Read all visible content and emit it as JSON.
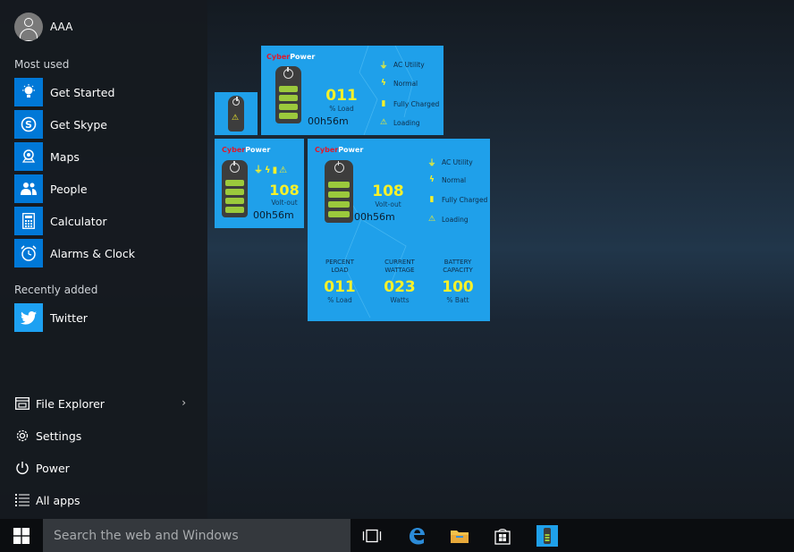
{
  "user": {
    "name": "AAA"
  },
  "sections": {
    "most_used": "Most used",
    "recently_added": "Recently added"
  },
  "apps": [
    {
      "label": "Get Started",
      "icon": "lightbulb-icon"
    },
    {
      "label": "Get Skype",
      "icon": "skype-icon"
    },
    {
      "label": "Maps",
      "icon": "maps-icon"
    },
    {
      "label": "People",
      "icon": "people-icon"
    },
    {
      "label": "Calculator",
      "icon": "calculator-icon"
    },
    {
      "label": "Alarms & Clock",
      "icon": "alarm-clock-icon"
    }
  ],
  "recent": [
    {
      "label": "Twitter",
      "icon": "twitter-icon"
    }
  ],
  "bottom": {
    "file_explorer": "File Explorer",
    "settings": "Settings",
    "power": "Power",
    "all_apps": "All apps"
  },
  "tiles": {
    "brand_a": "Cyber",
    "brand_b": "Power",
    "status": {
      "ac": "AC Utility",
      "normal": "Normal",
      "charged": "Fully Charged",
      "loading": "Loading"
    },
    "wide": {
      "value": "011",
      "caption": "% Load",
      "timer": "00h56m"
    },
    "medium": {
      "value": "108",
      "caption": "Volt-out",
      "timer": "00h56m"
    },
    "large": {
      "value": "108",
      "caption": "Volt-out",
      "timer": "00h56m",
      "stats": [
        {
          "head1": "PERCENT",
          "head2": "LOAD",
          "value": "011",
          "unit": "% Load"
        },
        {
          "head1": "CURRENT",
          "head2": "WATTAGE",
          "value": "023",
          "unit": "Watts"
        },
        {
          "head1": "BATTERY",
          "head2": "CAPACITY",
          "value": "100",
          "unit": "% Batt"
        }
      ]
    }
  },
  "taskbar": {
    "search_placeholder": "Search the web and Windows"
  },
  "colors": {
    "accent": "#0078d7",
    "tile": "#1fa0ea",
    "value": "#f6f12a",
    "battery_bar": "#9bc93c"
  }
}
